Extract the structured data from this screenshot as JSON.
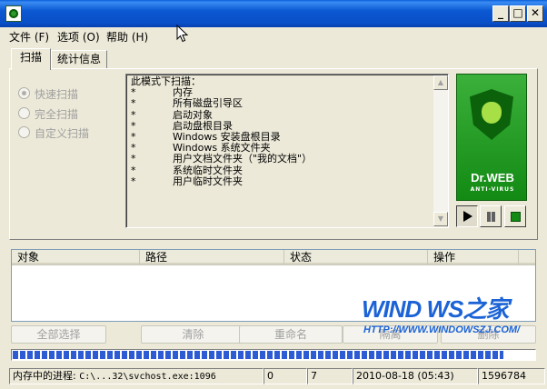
{
  "menu": [
    {
      "label": "文件",
      "key": "(F)"
    },
    {
      "label": "选项",
      "key": "(O)"
    },
    {
      "label": "帮助",
      "key": "(H)"
    }
  ],
  "window_buttons": {
    "minimize": "_",
    "maximize": "□",
    "close": "✕"
  },
  "tabs": [
    {
      "label": "扫描",
      "active": true
    },
    {
      "label": "统计信息",
      "active": false
    }
  ],
  "scan_modes": [
    {
      "label": "快速扫描",
      "selected": true
    },
    {
      "label": "完全扫描",
      "selected": false
    },
    {
      "label": "自定义扫描",
      "selected": false
    }
  ],
  "description": {
    "header": "此模式下扫描：",
    "bullet": "*",
    "items": [
      "内存",
      "所有磁盘引导区",
      "启动对象",
      "启动盘根目录",
      "Windows 安装盘根目录",
      "Windows 系统文件夹",
      "用户文档文件夹（\"我的文档\"）",
      "系统临时文件夹",
      "用户临时文件夹"
    ]
  },
  "logo": {
    "title": "Dr.WEB",
    "subtitle": "ANTI-VIRUS"
  },
  "list_columns": [
    "对象",
    "路径",
    "状态",
    "操作"
  ],
  "action_buttons": [
    "全部选择",
    "清除",
    "重命名",
    "隔离",
    "删除"
  ],
  "progress_fraction": 0.94,
  "status": {
    "label": "内存中的进程:",
    "path": "C:\\...32\\svchost.exe:1096",
    "count1": "0",
    "count2": "7",
    "datetime": "2010-08-18 (05:43)",
    "count3": "1596784"
  },
  "watermark": {
    "logo_text": "WIND WS之家",
    "url": "HTTP://WWW.WINDOWSZJ.COM/"
  },
  "colors": {
    "title_bar": "#0b58d2",
    "progress": "#2d5bd3",
    "logo_green": "#2a9d2a",
    "watermark_blue": "#1b63d6"
  }
}
